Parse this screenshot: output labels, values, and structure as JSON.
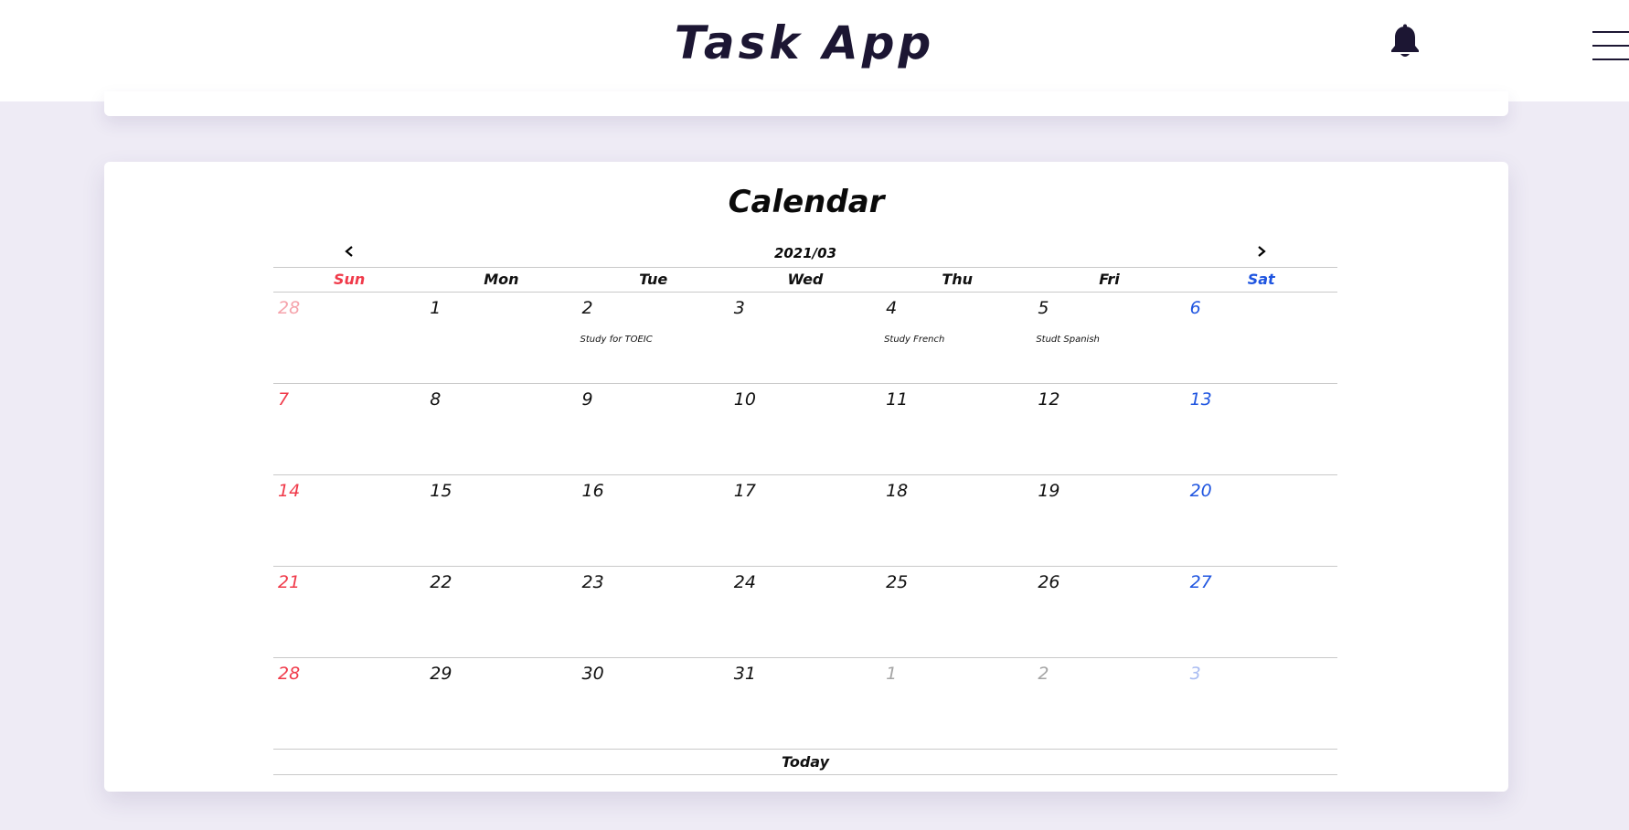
{
  "header": {
    "title": "Task App",
    "bell_icon": "bell-icon",
    "menu_icon": "hamburger-menu-icon"
  },
  "calendar": {
    "title": "Calendar",
    "month_label": "2021/03",
    "prev_icon": "chevron-left-icon",
    "next_icon": "chevron-right-icon",
    "weekdays": [
      "Sun",
      "Mon",
      "Tue",
      "Wed",
      "Thu",
      "Fri",
      "Sat"
    ],
    "weeks": [
      [
        {
          "day": "28",
          "other": true,
          "task": ""
        },
        {
          "day": "1",
          "other": false,
          "task": ""
        },
        {
          "day": "2",
          "other": false,
          "task": "Study for TOEIC"
        },
        {
          "day": "3",
          "other": false,
          "task": ""
        },
        {
          "day": "4",
          "other": false,
          "task": "Study French"
        },
        {
          "day": "5",
          "other": false,
          "task": "Studt Spanish"
        },
        {
          "day": "6",
          "other": false,
          "task": ""
        }
      ],
      [
        {
          "day": "7",
          "other": false,
          "task": ""
        },
        {
          "day": "8",
          "other": false,
          "task": ""
        },
        {
          "day": "9",
          "other": false,
          "task": ""
        },
        {
          "day": "10",
          "other": false,
          "task": ""
        },
        {
          "day": "11",
          "other": false,
          "task": ""
        },
        {
          "day": "12",
          "other": false,
          "task": ""
        },
        {
          "day": "13",
          "other": false,
          "task": ""
        }
      ],
      [
        {
          "day": "14",
          "other": false,
          "task": ""
        },
        {
          "day": "15",
          "other": false,
          "task": ""
        },
        {
          "day": "16",
          "other": false,
          "task": ""
        },
        {
          "day": "17",
          "other": false,
          "task": ""
        },
        {
          "day": "18",
          "other": false,
          "task": ""
        },
        {
          "day": "19",
          "other": false,
          "task": ""
        },
        {
          "day": "20",
          "other": false,
          "task": ""
        }
      ],
      [
        {
          "day": "21",
          "other": false,
          "task": ""
        },
        {
          "day": "22",
          "other": false,
          "task": ""
        },
        {
          "day": "23",
          "other": false,
          "task": ""
        },
        {
          "day": "24",
          "other": false,
          "task": ""
        },
        {
          "day": "25",
          "other": false,
          "task": ""
        },
        {
          "day": "26",
          "other": false,
          "task": ""
        },
        {
          "day": "27",
          "other": false,
          "task": ""
        }
      ],
      [
        {
          "day": "28",
          "other": false,
          "task": ""
        },
        {
          "day": "29",
          "other": false,
          "task": ""
        },
        {
          "day": "30",
          "other": false,
          "task": ""
        },
        {
          "day": "31",
          "other": false,
          "task": ""
        },
        {
          "day": "1",
          "other": true,
          "task": ""
        },
        {
          "day": "2",
          "other": true,
          "task": ""
        },
        {
          "day": "3",
          "other": true,
          "task": ""
        }
      ]
    ],
    "today_label": "Today"
  },
  "colors": {
    "title": "#1c1633",
    "background": "#eeebf5",
    "sunday": "#f03a4a",
    "saturday": "#1f55e0",
    "other_month": "#a5a5a5"
  }
}
